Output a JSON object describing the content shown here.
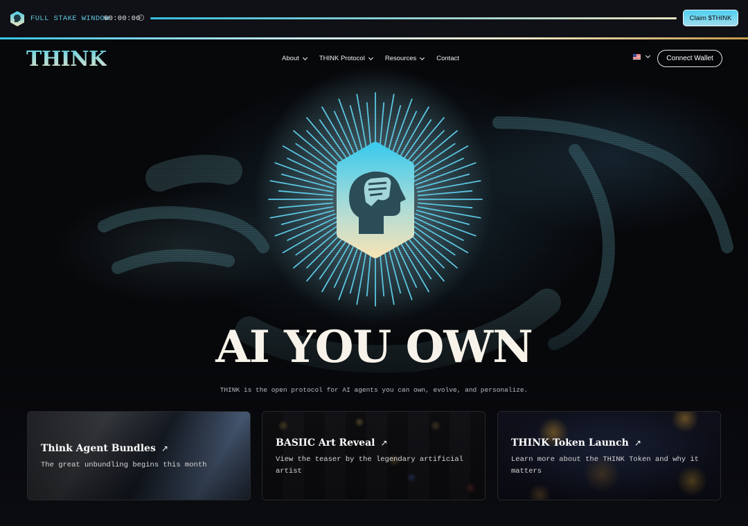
{
  "stake_bar": {
    "label": "FULL STAKE WINDOW",
    "timer": "00:00:00",
    "info_icon": "info-icon",
    "progress": 1.0,
    "claim_label": "Claim $THINK"
  },
  "nav": {
    "brand": "THINK",
    "items": [
      {
        "label": "About",
        "dropdown": true
      },
      {
        "label": "THINK Protocol",
        "dropdown": true
      },
      {
        "label": "Resources",
        "dropdown": true
      },
      {
        "label": "Contact",
        "dropdown": false
      }
    ],
    "language_icon": "us-flag-icon",
    "connect_label": "Connect Wallet"
  },
  "hero": {
    "emblem_icon": "fist-head-hexagon-icon",
    "headline": "AI YOU OWN",
    "subhead": "THINK is the open protocol for AI agents you can own, evolve, and personalize."
  },
  "cards": [
    {
      "title": "Think Agent Bundles",
      "description": "The great unbundling begins this month"
    },
    {
      "title": "BASIIC Art Reveal",
      "description": "View the teaser by the legendary artificial artist"
    },
    {
      "title": "THINK Token Launch",
      "description": "Learn more about the THINK Token and why it matters"
    }
  ],
  "colors": {
    "accent_cyan": "#37c6e6",
    "accent_cream": "#efe2bd",
    "background": "#0b0c10"
  }
}
